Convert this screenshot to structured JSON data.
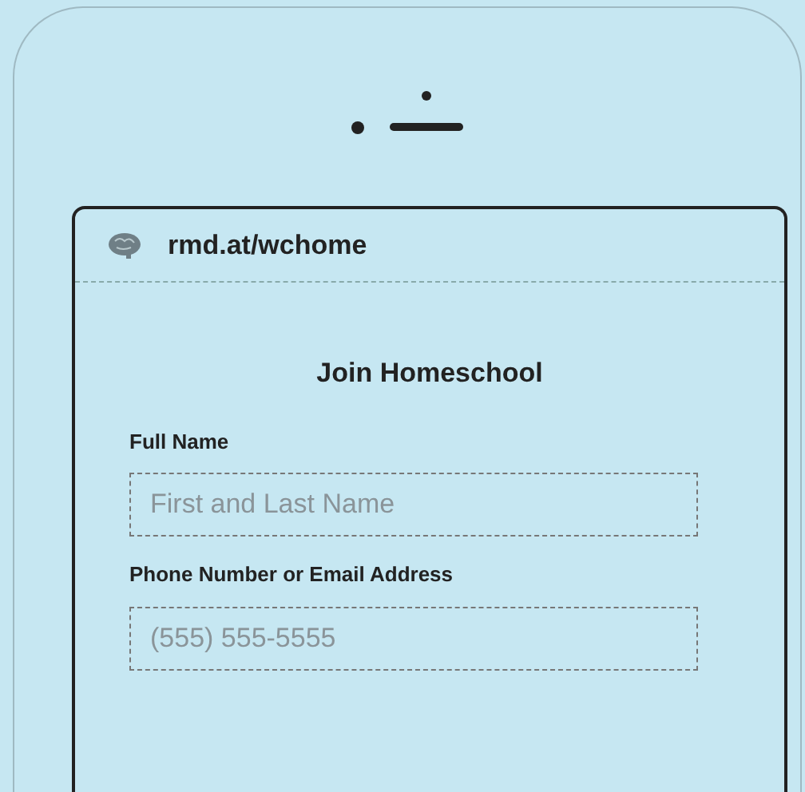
{
  "browser": {
    "url": "rmd.at/wchome"
  },
  "form": {
    "title": "Join Homeschool",
    "fields": [
      {
        "label": "Full Name",
        "placeholder": "First and Last Name"
      },
      {
        "label": "Phone Number or Email Address",
        "placeholder": "(555) 555-5555"
      }
    ]
  }
}
